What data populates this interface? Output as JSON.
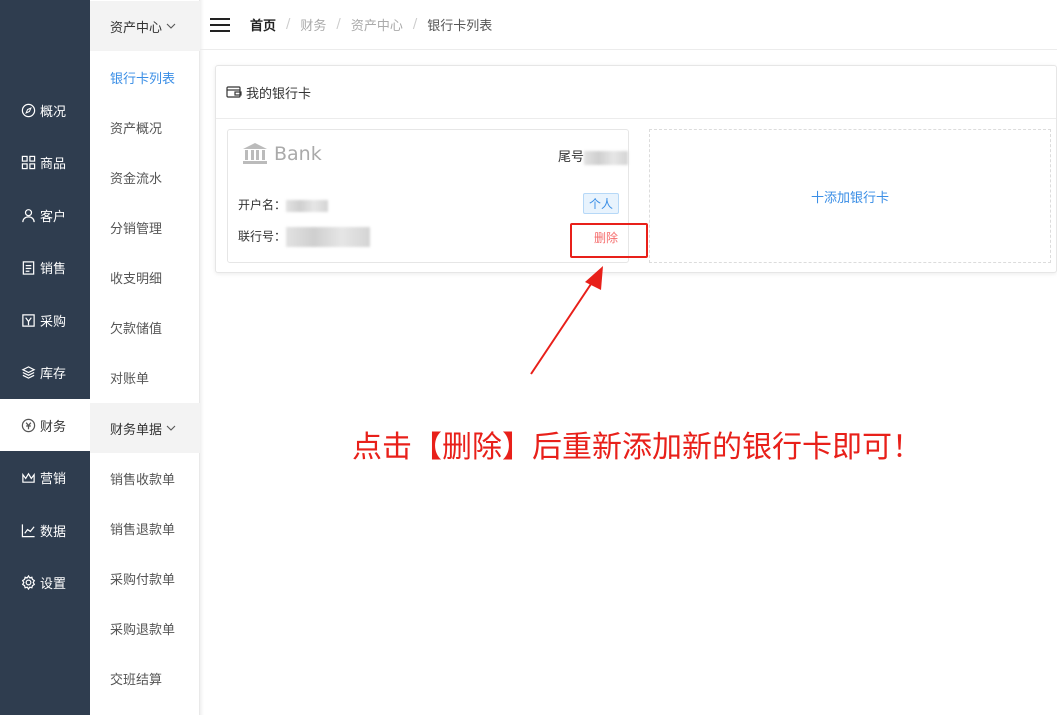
{
  "nav": {
    "items": [
      {
        "label": "概况",
        "icon": "compass-icon"
      },
      {
        "label": "商品",
        "icon": "grid-icon"
      },
      {
        "label": "客户",
        "icon": "user-icon"
      },
      {
        "label": "销售",
        "icon": "clipboard-icon"
      },
      {
        "label": "采购",
        "icon": "cart-icon"
      },
      {
        "label": "库存",
        "icon": "layers-icon"
      },
      {
        "label": "财务",
        "icon": "finance-icon",
        "active": true
      },
      {
        "label": "营销",
        "icon": "crown-icon"
      },
      {
        "label": "数据",
        "icon": "chart-line-icon"
      },
      {
        "label": "设置",
        "icon": "gear-icon"
      }
    ]
  },
  "submenu": {
    "group1": "资产中心",
    "items1": [
      "银行卡列表",
      "资产概况",
      "资金流水",
      "分销管理",
      "收支明细",
      "欠款储值",
      "对账单"
    ],
    "group2": "财务单据",
    "items2": [
      "销售收款单",
      "销售退款单",
      "采购付款单",
      "采购退款单",
      "交班结算"
    ]
  },
  "breadcrumb": [
    "首页",
    "财务",
    "资产中心",
    "银行卡列表"
  ],
  "panel": {
    "title": "我的银行卡",
    "card": {
      "bank": "Bank",
      "tail_label": "尾号",
      "holder_label": "开户名：",
      "branch_label": "联行号：",
      "tag": "个人",
      "delete": "删除"
    },
    "add_label": "十添加银行卡"
  },
  "annotation": {
    "text": "点击【删除】后重新添加新的银行卡即可！",
    "color": "#e8201a"
  },
  "colors": {
    "nav_bg": "#2f3d4f",
    "accent": "#3a8ee6",
    "danger": "#f56c6c"
  }
}
